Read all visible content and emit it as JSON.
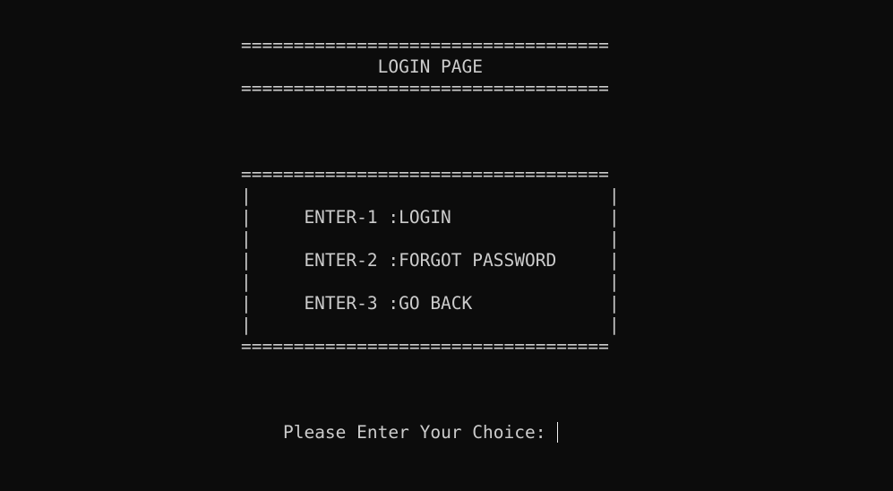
{
  "header": {
    "rule_top": "===================================",
    "title": "             LOGIN PAGE",
    "rule_bottom": "==================================="
  },
  "menu": {
    "rule_top": "===================================",
    "blank_1": "|                                  |",
    "option_1": "|     ENTER-1 :LOGIN               |",
    "blank_2": "|                                  |",
    "option_2": "|     ENTER-2 :FORGOT PASSWORD     |",
    "blank_3": "|                                  |",
    "option_3": "|     ENTER-3 :GO BACK             |",
    "blank_4": "|                                  |",
    "rule_bottom": "==================================="
  },
  "prompt": {
    "text": "Please Enter Your Choice: ",
    "input_value": ""
  }
}
